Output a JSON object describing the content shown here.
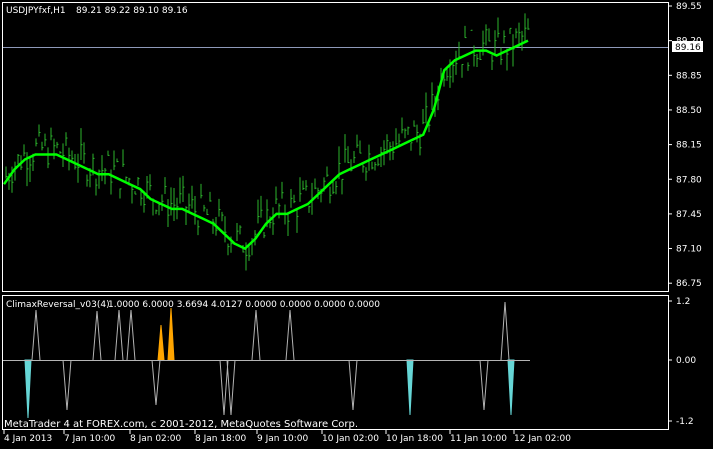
{
  "main_header": {
    "symbol": "USDJPYfxf,H1",
    "ohlc": "89.21 89.22 89.10 89.16"
  },
  "indicator_header": {
    "name": "ClimaxReversal_v03(4)",
    "values": "1.0000 6.0000 3.6694 4.0127 0.0000 0.0000 0.0000 0.0000"
  },
  "price_axis": {
    "ticks": [
      "89.55",
      "89.20",
      "88.85",
      "88.50",
      "88.15",
      "87.80",
      "87.45",
      "87.10",
      "86.75"
    ],
    "current_price": "89.16"
  },
  "indicator_axis": {
    "ticks": [
      "1.2",
      "0.00",
      "-1.2"
    ]
  },
  "time_axis": {
    "labels": [
      "4 Jan 2013",
      "7 Jan 10:00",
      "8 Jan 02:00",
      "8 Jan 18:00",
      "9 Jan 10:00",
      "10 Jan 02:00",
      "10 Jan 18:00",
      "11 Jan 10:00",
      "12 Jan 02:00"
    ]
  },
  "watermark": "MetaTrader 4 at FOREX.com, c 2001-2012, MetaQuotes Software Corp.",
  "colors": {
    "background": "#000000",
    "frame": "#ffffff",
    "bars": "#2db52d",
    "ma_line": "#00ff00",
    "current_line": "#8e99b9",
    "spike_line": "#b4b4b4",
    "spike_down": "#66d6d6",
    "spike_up": "#ffa500"
  },
  "chart_data": {
    "type": "line",
    "series": [
      {
        "values": [
          87.75,
          87.9,
          88.0,
          88.05,
          88.05,
          88.05,
          88.0,
          87.95,
          87.9,
          87.85,
          87.85,
          87.8,
          87.75,
          87.7,
          87.6,
          87.55,
          87.5,
          87.5,
          87.45,
          87.4,
          87.35,
          87.25,
          87.15,
          87.1,
          87.2,
          87.35,
          87.45,
          87.45,
          87.5,
          87.55,
          87.65,
          87.75,
          87.85,
          87.9,
          87.95,
          88.0,
          88.05,
          88.1,
          88.15,
          88.2,
          88.25,
          88.5,
          88.9,
          89.0,
          89.05,
          89.1,
          89.1,
          89.05,
          89.1,
          89.15,
          89.2
        ]
      }
    ],
    "ylim": [
      86.7,
      89.6
    ],
    "indicator": {
      "ylim": [
        -1.2,
        1.2
      ]
    }
  }
}
